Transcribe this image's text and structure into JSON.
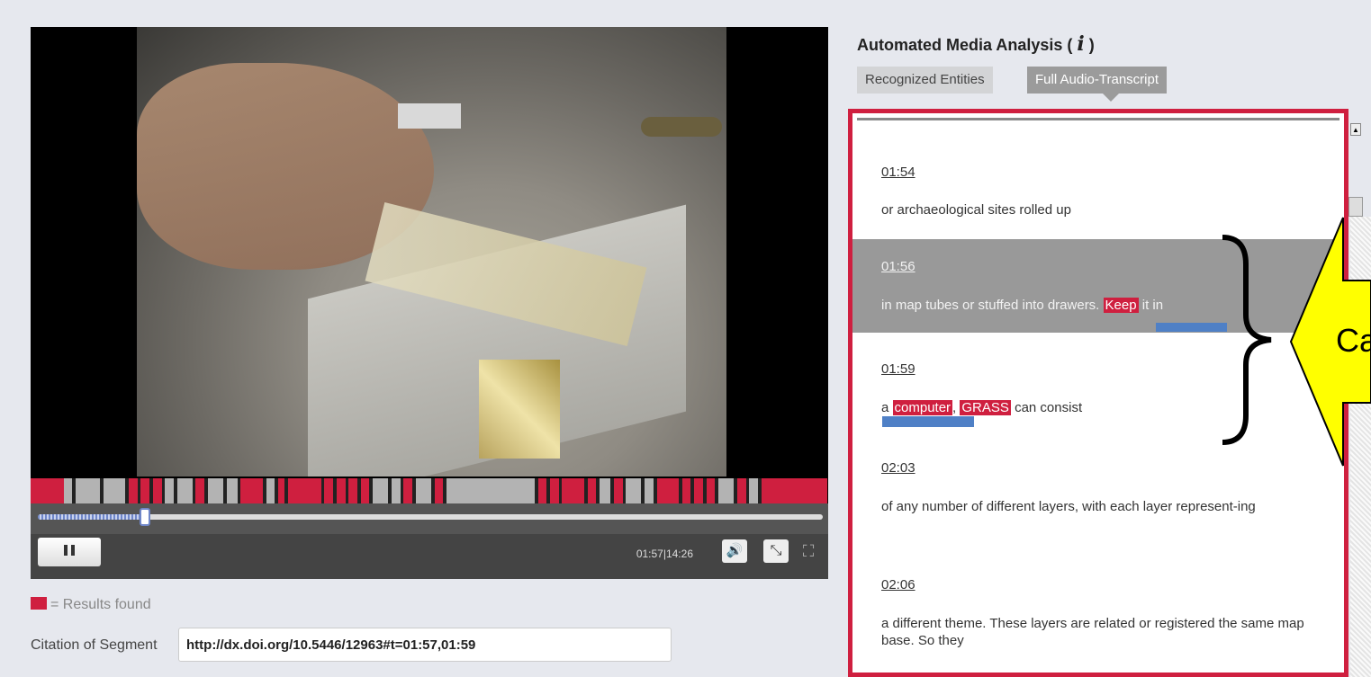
{
  "player": {
    "time_display": "01:57|14:26",
    "progress_fraction": 0.136,
    "markers": [
      [
        "r",
        30
      ],
      [
        "g",
        8
      ],
      [
        "k",
        3
      ],
      [
        "g",
        22
      ],
      [
        "k",
        3
      ],
      [
        "g",
        20
      ],
      [
        "k",
        3
      ],
      [
        "r",
        8
      ],
      [
        "k",
        3
      ],
      [
        "r",
        8
      ],
      [
        "k",
        3
      ],
      [
        "r",
        8
      ],
      [
        "k",
        3
      ],
      [
        "g",
        8
      ],
      [
        "k",
        3
      ],
      [
        "g",
        14
      ],
      [
        "k",
        3
      ],
      [
        "r",
        8
      ],
      [
        "k",
        3
      ],
      [
        "g",
        14
      ],
      [
        "k",
        3
      ],
      [
        "g",
        10
      ],
      [
        "k",
        3
      ],
      [
        "r",
        20
      ],
      [
        "k",
        3
      ],
      [
        "g",
        8
      ],
      [
        "k",
        3
      ],
      [
        "r",
        6
      ],
      [
        "k",
        3
      ],
      [
        "r",
        30
      ],
      [
        "k",
        3
      ],
      [
        "r",
        8
      ],
      [
        "k",
        3
      ],
      [
        "r",
        8
      ],
      [
        "k",
        3
      ],
      [
        "r",
        8
      ],
      [
        "k",
        3
      ],
      [
        "r",
        8
      ],
      [
        "k",
        3
      ],
      [
        "g",
        14
      ],
      [
        "k",
        3
      ],
      [
        "g",
        8
      ],
      [
        "k",
        3
      ],
      [
        "r",
        8
      ],
      [
        "k",
        3
      ],
      [
        "g",
        14
      ],
      [
        "k",
        3
      ],
      [
        "r",
        8
      ],
      [
        "k",
        3
      ],
      [
        "g",
        80
      ],
      [
        "k",
        3
      ],
      [
        "r",
        8
      ],
      [
        "k",
        3
      ],
      [
        "r",
        8
      ],
      [
        "k",
        3
      ],
      [
        "r",
        20
      ],
      [
        "k",
        3
      ],
      [
        "r",
        8
      ],
      [
        "k",
        3
      ],
      [
        "g",
        10
      ],
      [
        "k",
        3
      ],
      [
        "r",
        8
      ],
      [
        "k",
        3
      ],
      [
        "g",
        14
      ],
      [
        "k",
        3
      ],
      [
        "g",
        8
      ],
      [
        "k",
        3
      ],
      [
        "r",
        20
      ],
      [
        "k",
        3
      ],
      [
        "r",
        8
      ],
      [
        "k",
        3
      ],
      [
        "r",
        8
      ],
      [
        "k",
        3
      ],
      [
        "r",
        8
      ],
      [
        "k",
        3
      ],
      [
        "g",
        14
      ],
      [
        "k",
        3
      ],
      [
        "r",
        8
      ],
      [
        "k",
        3
      ],
      [
        "g",
        8
      ],
      [
        "k",
        3
      ],
      [
        "r",
        60
      ]
    ],
    "colors": {
      "result": "#cf1f3f",
      "segment": "#b3b3b3",
      "gap": "#222222"
    }
  },
  "legend": {
    "label": "= Results found"
  },
  "citation": {
    "label": "Citation of Segment",
    "value": "http://dx.doi.org/10.5446/12963#t=01:57,01:59"
  },
  "analysis": {
    "title": "Automated Media Analysis (",
    "info_glyph": "i",
    "title_end": ")",
    "tabs": {
      "entities": "Recognized Entities",
      "transcript": "Full Audio-Transcript"
    }
  },
  "transcript": [
    {
      "time": "01:54",
      "text": "or archaeological sites rolled up"
    },
    {
      "time": "01:56",
      "text_before": "in map tubes or stuffed into drawers. ",
      "keyword": "Keep",
      "text_after": " it in"
    },
    {
      "time": "01:59",
      "text_before": "a ",
      "keyword": "computer",
      "separator": ", ",
      "keyword2": "GRASS",
      "text_after": " can consist"
    },
    {
      "time": "02:03",
      "text": "of any number of different layers, with each layer represent-ing"
    },
    {
      "time": "02:06",
      "text": "a different theme. These layers are related or registered the same map base. So they"
    }
  ],
  "callout": {
    "text": "Ca"
  },
  "icons": {
    "pause": "pause-icon",
    "volume": "volume-icon",
    "expand": "expand-icon",
    "fullscreen": "fullscreen-icon",
    "info": "info-icon"
  }
}
